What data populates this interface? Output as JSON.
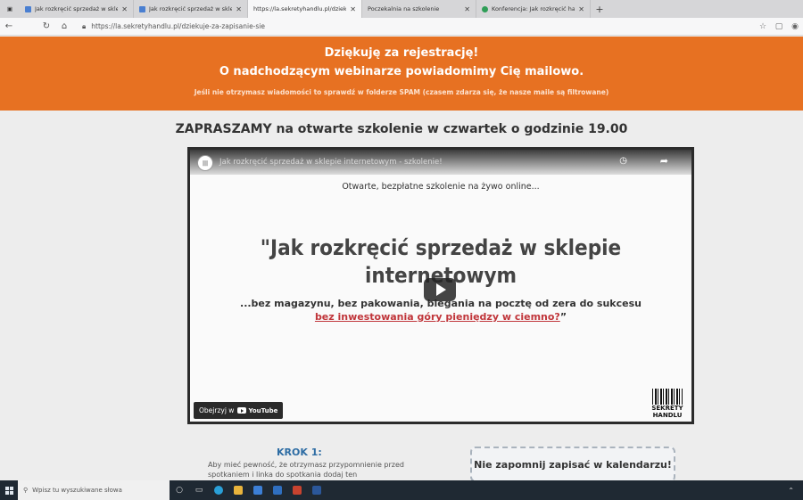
{
  "browser": {
    "tabs": [
      {
        "title": "Jak rozkręcić sprzedaż w sklepie",
        "active": false
      },
      {
        "title": "Jak rozkręcić sprzedaż w sklepie",
        "active": false
      },
      {
        "title": "https://la.sekretyhandlu.pl/dziek",
        "active": true
      },
      {
        "title": "Poczekalnia na szkolenie",
        "active": false
      },
      {
        "title": "Konferencja: Jak rozkręcić handle",
        "active": false
      }
    ],
    "url": "https://la.sekretyhandlu.pl/dziekuje-za-zapisanie-sie"
  },
  "banner": {
    "line1": "Dziękuję za rejestrację!",
    "line2": "O nadchodzącym webinarze powiadomimy Cię mailowo.",
    "note": "Jeśli nie otrzymasz wiadomości to sprawdź w folderze SPAM (czasem zdarza się, że nasze maile są filtrowane)"
  },
  "invite_heading": "ZAPRASZAMY na otwarte szkolenie w czwartek o godzinie 19.00",
  "video": {
    "title": "Jak rozkręcić sprzedaż w sklepie internetowym - szkolenie!",
    "subtitle": "Otwarte, bezpłatne szkolenie na żywo online...",
    "headline_1": "\"Jak rozkręcić sprzedaż w sklepie",
    "headline_2": "internetowym",
    "tagline": "...bez magazynu, bez pakowania, biegania na pocztę od zera do sukcesu",
    "link_text": "bez inwestowania góry pieniędzy w ciemno?",
    "link_suffix": "”",
    "watch_on": "Obejrzyj w",
    "youtube": "YouTube",
    "brand_line1": "SEKRETY",
    "brand_line2": "HANDLU"
  },
  "step": {
    "title": "KROK 1:",
    "text": "Aby mieć pewność, że otrzymasz przypomnienie przed spotkaniem i linka do spotkania dodaj ten"
  },
  "calendar_box": "Nie zapomnij zapisać w kalendarzu!",
  "taskbar": {
    "search_placeholder": "Wpisz tu wyszukiwane słowa"
  }
}
